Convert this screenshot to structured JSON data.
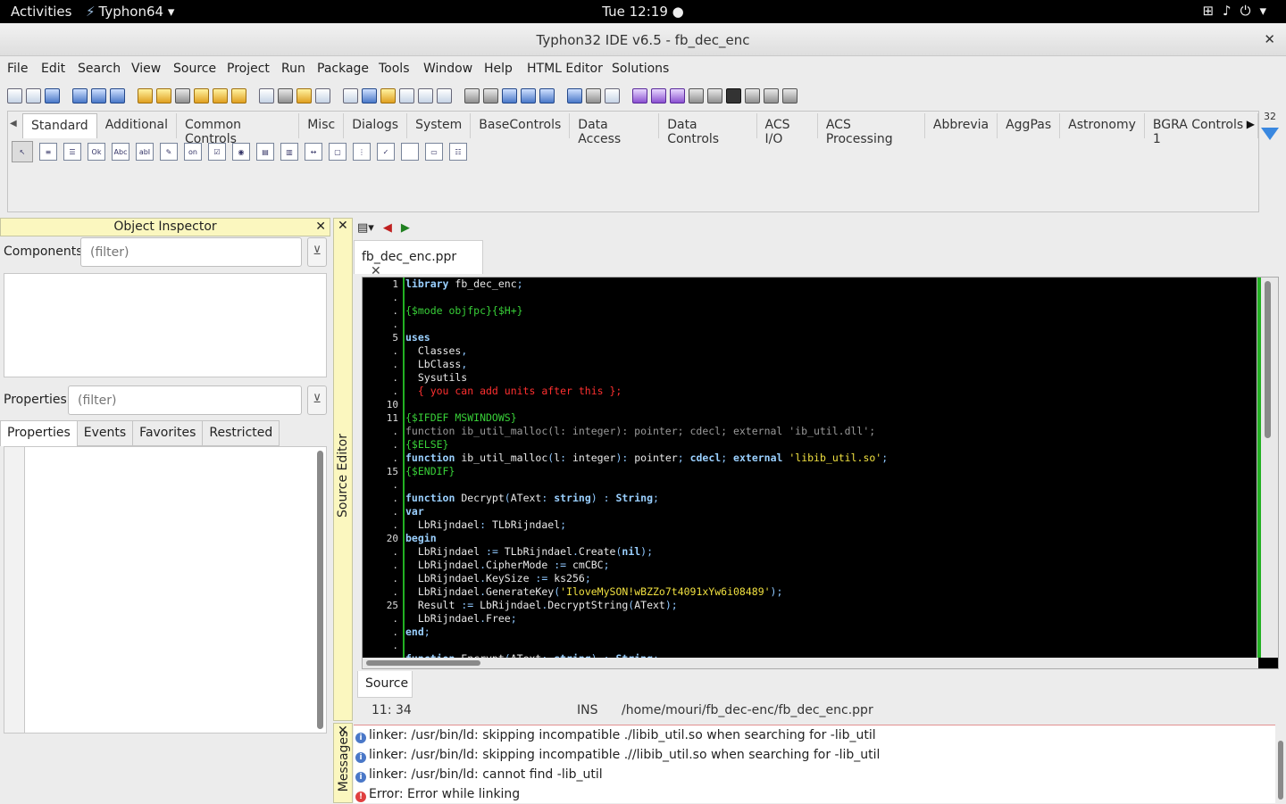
{
  "topbar": {
    "activities": "Activities",
    "app_name": "Typhon64",
    "app_menu_arrow": "▾",
    "clock": "Tue 12:19",
    "clock_dot": "●",
    "tray_icons": [
      "network-icon",
      "volume-icon",
      "power-icon",
      "chevron-down-icon"
    ]
  },
  "window": {
    "title": "Typhon32 IDE v6.5 - fb_dec_enc",
    "close": "✕"
  },
  "menu": [
    "File",
    "Edit",
    "Search",
    "View",
    "Source",
    "Project",
    "Run",
    "Package",
    "Tools",
    "Window",
    "Help",
    "HTML Editor",
    "Solutions"
  ],
  "palette": {
    "tabs": [
      "Standard",
      "Additional",
      "Common Controls",
      "Misc",
      "Dialogs",
      "System",
      "BaseControls",
      "Data Access",
      "Data Controls",
      "ACS I/O",
      "ACS Processing",
      "Abbrevia",
      "AggPas",
      "Astronomy",
      "BGRA Controls 1"
    ],
    "active_tab": "Standard",
    "items": [
      "Ok",
      "Abc",
      "abI",
      "on"
    ],
    "icon_size": "32"
  },
  "object_inspector": {
    "title": "Object Inspector",
    "close": "✕",
    "components_label": "Components",
    "components_filter_placeholder": "(filter)",
    "properties_label": "Properties",
    "properties_filter_placeholder": "(filter)",
    "tabs": [
      "Properties",
      "Events",
      "Favorites",
      "Restricted"
    ],
    "active_tab": "Properties"
  },
  "source_editor": {
    "strip_label": "Source Editor",
    "close": "✕",
    "tab_name": "fb_dec_enc.ppr",
    "tab_close": "✕",
    "bottom_tab": "Source",
    "gutter": [
      "1",
      ".",
      ".",
      ".",
      "5",
      ".",
      ".",
      ".",
      ".",
      "10",
      "11",
      ".",
      ".",
      ".",
      "15",
      ".",
      ".",
      ".",
      ".",
      "20",
      ".",
      ".",
      ".",
      ".",
      "25",
      ".",
      ".",
      ".",
      "."
    ],
    "lines": [
      [
        [
          "kw",
          "library"
        ],
        [
          "",
          " fb_dec_enc"
        ],
        [
          "sym",
          ";"
        ]
      ],
      [],
      [
        [
          "dir",
          "{$mode objfpc}{$H+}"
        ]
      ],
      [],
      [
        [
          "kw",
          "uses"
        ]
      ],
      [
        [
          "",
          "  Classes"
        ],
        [
          "sym",
          ","
        ]
      ],
      [
        [
          "",
          "  LbClass"
        ],
        [
          "sym",
          ","
        ]
      ],
      [
        [
          "",
          "  Sysutils"
        ]
      ],
      [
        [
          "cmt",
          "  { you can add units after this };"
        ]
      ],
      [],
      [
        [
          "dir",
          "{$IFDEF MSWINDOWS}"
        ]
      ],
      [
        [
          "inact",
          "function ib_util_malloc(l: integer): pointer; cdecl; external 'ib_util.dll';"
        ]
      ],
      [
        [
          "dir",
          "{$ELSE}"
        ]
      ],
      [
        [
          "kw",
          "function"
        ],
        [
          "",
          " ib_util_malloc"
        ],
        [
          "sym",
          "("
        ],
        [
          "",
          "l"
        ],
        [
          "sym",
          ":"
        ],
        [
          "",
          " integer"
        ],
        [
          "sym",
          "):"
        ],
        [
          "",
          " pointer"
        ],
        [
          "sym",
          ";"
        ],
        [
          "kw",
          " cdecl"
        ],
        [
          "sym",
          ";"
        ],
        [
          "kw",
          " external"
        ],
        [
          "str",
          " 'libib_util.so'"
        ],
        [
          "sym",
          ";"
        ]
      ],
      [
        [
          "dir",
          "{$ENDIF}"
        ]
      ],
      [],
      [
        [
          "kw",
          "function"
        ],
        [
          "",
          " Decrypt"
        ],
        [
          "sym",
          "("
        ],
        [
          "",
          "AText"
        ],
        [
          "sym",
          ":"
        ],
        [
          "kw",
          " string"
        ],
        [
          "sym",
          ") :"
        ],
        [
          "kw",
          " String"
        ],
        [
          "sym",
          ";"
        ]
      ],
      [
        [
          "kw",
          "var"
        ]
      ],
      [
        [
          "",
          "  LbRijndael"
        ],
        [
          "sym",
          ":"
        ],
        [
          "",
          " TLbRijndael"
        ],
        [
          "sym",
          ";"
        ]
      ],
      [
        [
          "kw",
          "begin"
        ]
      ],
      [
        [
          "",
          "  LbRijndael "
        ],
        [
          "sym",
          ":="
        ],
        [
          "",
          " TLbRijndael"
        ],
        [
          "sym",
          "."
        ],
        [
          "",
          "Create"
        ],
        [
          "sym",
          "("
        ],
        [
          "kw",
          "nil"
        ],
        [
          "sym",
          ");"
        ]
      ],
      [
        [
          "",
          "  LbRijndael"
        ],
        [
          "sym",
          "."
        ],
        [
          "",
          "CipherMode "
        ],
        [
          "sym",
          ":="
        ],
        [
          "",
          " cmCBC"
        ],
        [
          "sym",
          ";"
        ]
      ],
      [
        [
          "",
          "  LbRijndael"
        ],
        [
          "sym",
          "."
        ],
        [
          "",
          "KeySize "
        ],
        [
          "sym",
          ":="
        ],
        [
          "",
          " ks256"
        ],
        [
          "sym",
          ";"
        ]
      ],
      [
        [
          "",
          "  LbRijndael"
        ],
        [
          "sym",
          "."
        ],
        [
          "",
          "GenerateKey"
        ],
        [
          "sym",
          "("
        ],
        [
          "str",
          "'IloveMySON!wBZZo7t4091xYw6i08489'"
        ],
        [
          "sym",
          ");"
        ]
      ],
      [
        [
          "",
          "  Result "
        ],
        [
          "sym",
          ":="
        ],
        [
          "",
          " LbRijndael"
        ],
        [
          "sym",
          "."
        ],
        [
          "",
          "DecryptString"
        ],
        [
          "sym",
          "("
        ],
        [
          "",
          "AText"
        ],
        [
          "sym",
          ");"
        ]
      ],
      [
        [
          "",
          "  LbRijndael"
        ],
        [
          "sym",
          "."
        ],
        [
          "",
          "Free"
        ],
        [
          "sym",
          ";"
        ]
      ],
      [
        [
          "kw",
          "end"
        ],
        [
          "sym",
          ";"
        ]
      ],
      [],
      [
        [
          "kw",
          "function"
        ],
        [
          "",
          " Encrypt"
        ],
        [
          "sym",
          "("
        ],
        [
          "",
          "AText"
        ],
        [
          "sym",
          ":"
        ],
        [
          "kw",
          " string"
        ],
        [
          "sym",
          ") :"
        ],
        [
          "kw",
          " String"
        ],
        [
          "sym",
          ";"
        ]
      ]
    ]
  },
  "status": {
    "cursor_pos": "11: 34",
    "mode": "INS",
    "file_path": "/home/mouri/fb_dec-enc/fb_dec_enc.ppr"
  },
  "messages": {
    "strip_label": "Messages",
    "close": "✕",
    "items": [
      {
        "type": "info",
        "text": "linker: /usr/bin/ld: skipping incompatible ./libib_util.so when searching for -lib_util"
      },
      {
        "type": "info",
        "text": "linker: /usr/bin/ld: skipping incompatible .//libib_util.so when searching for -lib_util"
      },
      {
        "type": "info",
        "text": "linker: /usr/bin/ld: cannot find -lib_util"
      },
      {
        "type": "error",
        "text": "Error: Error while linking"
      }
    ]
  }
}
